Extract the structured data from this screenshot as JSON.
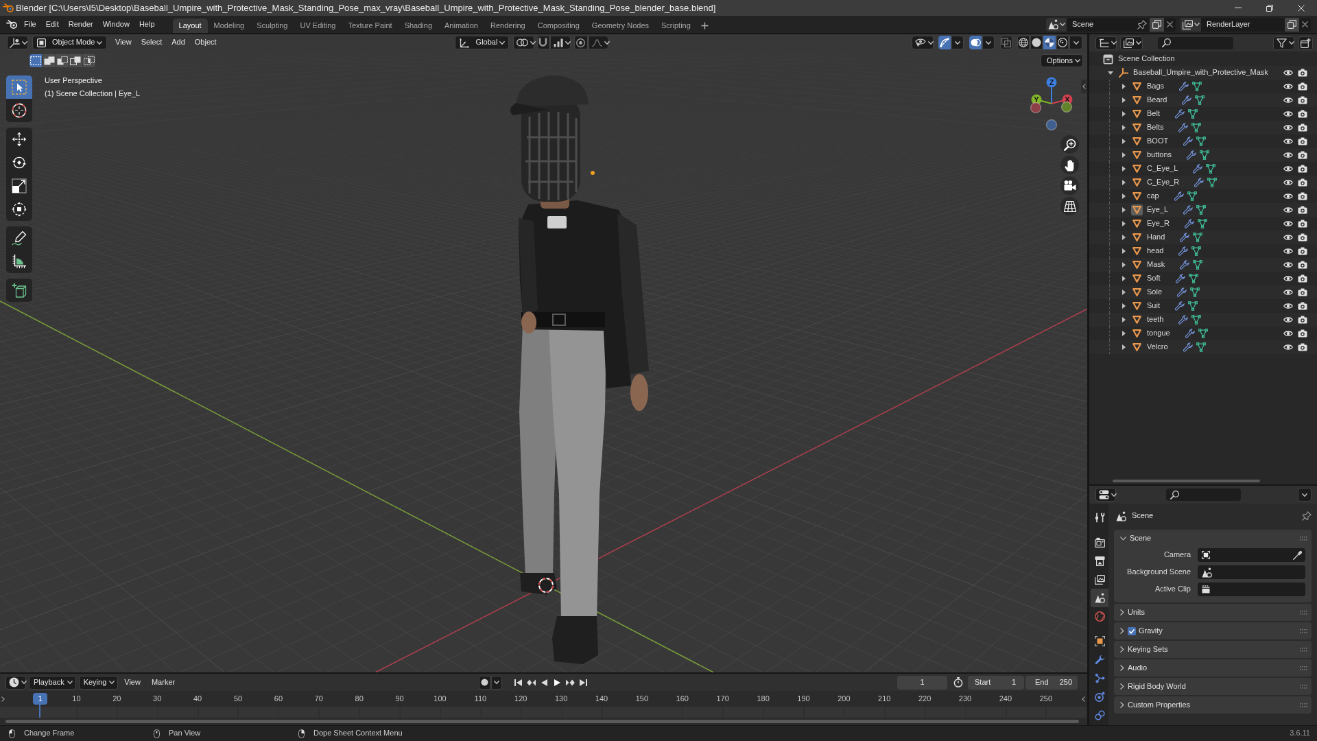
{
  "window": {
    "title": "Blender [C:\\Users\\I5\\Desktop\\Baseball_Umpire_with_Protective_Mask_Standing_Pose_max_vray\\Baseball_Umpire_with_Protective_Mask_Standing_Pose_blender_base.blend]"
  },
  "menu": [
    "File",
    "Edit",
    "Render",
    "Window",
    "Help"
  ],
  "workspaces": [
    {
      "label": "Layout",
      "selected": true
    },
    {
      "label": "Modeling",
      "selected": false
    },
    {
      "label": "Sculpting",
      "selected": false
    },
    {
      "label": "UV Editing",
      "selected": false
    },
    {
      "label": "Texture Paint",
      "selected": false
    },
    {
      "label": "Shading",
      "selected": false
    },
    {
      "label": "Animation",
      "selected": false
    },
    {
      "label": "Rendering",
      "selected": false
    },
    {
      "label": "Compositing",
      "selected": false
    },
    {
      "label": "Geometry Nodes",
      "selected": false
    },
    {
      "label": "Scripting",
      "selected": false
    }
  ],
  "scene": {
    "name": "Scene"
  },
  "view_layer": {
    "name": "RenderLayer"
  },
  "viewport": {
    "mode": "Object Mode",
    "menus": [
      "View",
      "Select",
      "Add",
      "Object"
    ],
    "orientation": "Global",
    "snap": false,
    "proportional_editing": false,
    "gizmos": true,
    "overlays": true,
    "xray": false,
    "shading": [
      {
        "kind": "wireframe",
        "selected": false
      },
      {
        "kind": "solid",
        "selected": false
      },
      {
        "kind": "material",
        "selected": true
      },
      {
        "kind": "rendered",
        "selected": false
      }
    ],
    "options": "Options",
    "select_modes": [
      {
        "kind": "set",
        "selected": true
      },
      {
        "kind": "extend",
        "selected": false
      },
      {
        "kind": "subtract",
        "selected": false
      },
      {
        "kind": "invert",
        "selected": false
      },
      {
        "kind": "intersect",
        "selected": false
      }
    ],
    "toolbar": [
      {
        "tools": [
          {
            "kind": "select_box",
            "selected": true
          },
          {
            "kind": "cursor",
            "selected": false
          }
        ]
      },
      {
        "tools": [
          {
            "kind": "move",
            "selected": false
          },
          {
            "kind": "rotate",
            "selected": false
          },
          {
            "kind": "scale",
            "selected": false
          },
          {
            "kind": "transform",
            "selected": false
          }
        ]
      },
      {
        "tools": [
          {
            "kind": "annotate",
            "selected": false
          },
          {
            "kind": "measure",
            "selected": false
          }
        ]
      },
      {
        "tools": [
          {
            "kind": "add_cube",
            "selected": false
          }
        ]
      }
    ],
    "info": [
      "User Perspective",
      "(1) Scene Collection | Eye_L"
    ],
    "axes": [
      {
        "kind": "positive",
        "label": "Z",
        "color": "#3d7fe0"
      },
      {
        "kind": "positive",
        "label": "Y",
        "color": "#82b428"
      },
      {
        "kind": "positive",
        "label": "X",
        "color": "#d0404f"
      },
      {
        "kind": "negative",
        "color": "#3e5f8f"
      },
      {
        "kind": "negative",
        "color": "#62822c"
      },
      {
        "kind": "negative",
        "color": "#8e4049"
      }
    ]
  },
  "outliner": {
    "root": "Scene Collection",
    "tree": [
      {
        "name": "Baseball_Umpire_with_Protective_Mask",
        "kind": "empty",
        "expanded": true,
        "selected": false,
        "visible": true,
        "renderable": true,
        "children": [
          {
            "name": "Bags",
            "kind": "mesh",
            "expanded": false,
            "selected": false,
            "modifiers": true,
            "visible": true,
            "renderable": true
          },
          {
            "name": "Beard",
            "kind": "mesh",
            "expanded": false,
            "selected": false,
            "modifiers": true,
            "visible": true,
            "renderable": true
          },
          {
            "name": "Belt",
            "kind": "mesh",
            "expanded": false,
            "selected": false,
            "modifiers": true,
            "visible": true,
            "renderable": true
          },
          {
            "name": "Belts",
            "kind": "mesh",
            "expanded": false,
            "selected": false,
            "modifiers": true,
            "visible": true,
            "renderable": true
          },
          {
            "name": "BOOT",
            "kind": "mesh",
            "expanded": false,
            "selected": false,
            "modifiers": true,
            "visible": true,
            "renderable": true
          },
          {
            "name": "buttons",
            "kind": "mesh",
            "expanded": false,
            "selected": false,
            "modifiers": true,
            "visible": true,
            "renderable": true
          },
          {
            "name": "C_Eye_L",
            "kind": "mesh",
            "expanded": false,
            "selected": false,
            "modifiers": true,
            "visible": true,
            "renderable": true
          },
          {
            "name": "C_Eye_R",
            "kind": "mesh",
            "expanded": false,
            "selected": false,
            "modifiers": true,
            "visible": true,
            "renderable": true
          },
          {
            "name": "cap",
            "kind": "mesh",
            "expanded": false,
            "selected": false,
            "modifiers": true,
            "visible": true,
            "renderable": true
          },
          {
            "name": "Eye_L",
            "kind": "mesh",
            "expanded": false,
            "selected": true,
            "modifiers": true,
            "visible": true,
            "renderable": true
          },
          {
            "name": "Eye_R",
            "kind": "mesh",
            "expanded": false,
            "selected": false,
            "modifiers": true,
            "visible": true,
            "renderable": true
          },
          {
            "name": "Hand",
            "kind": "mesh",
            "expanded": false,
            "selected": false,
            "modifiers": true,
            "visible": true,
            "renderable": true
          },
          {
            "name": "head",
            "kind": "mesh",
            "expanded": false,
            "selected": false,
            "modifiers": true,
            "visible": true,
            "renderable": true
          },
          {
            "name": "Mask",
            "kind": "mesh",
            "expanded": false,
            "selected": false,
            "modifiers": true,
            "visible": true,
            "renderable": true
          },
          {
            "name": "Soft",
            "kind": "mesh",
            "expanded": false,
            "selected": false,
            "modifiers": true,
            "visible": true,
            "renderable": true
          },
          {
            "name": "Sole",
            "kind": "mesh",
            "expanded": false,
            "selected": false,
            "modifiers": true,
            "visible": true,
            "renderable": true
          },
          {
            "name": "Suit",
            "kind": "mesh",
            "expanded": false,
            "selected": false,
            "modifiers": true,
            "visible": true,
            "renderable": true
          },
          {
            "name": "teeth",
            "kind": "mesh",
            "expanded": false,
            "selected": false,
            "modifiers": true,
            "visible": true,
            "renderable": true
          },
          {
            "name": "tongue",
            "kind": "mesh",
            "expanded": false,
            "selected": false,
            "modifiers": true,
            "visible": true,
            "renderable": true
          },
          {
            "name": "Velcro",
            "kind": "mesh",
            "expanded": false,
            "selected": false,
            "modifiers": true,
            "visible": true,
            "renderable": true
          }
        ]
      }
    ]
  },
  "properties": {
    "tab_groups": [
      {
        "tabs": [
          {
            "kind": "tool",
            "selected": false
          }
        ]
      },
      {
        "tabs": [
          {
            "kind": "render",
            "selected": false
          },
          {
            "kind": "output",
            "selected": false
          },
          {
            "kind": "view_layer",
            "selected": false
          },
          {
            "kind": "scene",
            "selected": true
          },
          {
            "kind": "world",
            "selected": false
          }
        ]
      },
      {
        "tabs": [
          {
            "kind": "object",
            "selected": false
          },
          {
            "kind": "modifiers",
            "selected": false
          },
          {
            "kind": "particles",
            "selected": false
          },
          {
            "kind": "physics",
            "selected": false
          },
          {
            "kind": "constraints",
            "selected": false
          }
        ]
      }
    ],
    "context": "Scene",
    "panels": [
      {
        "title": "Scene",
        "kind": "plain",
        "expanded": true,
        "fields": [
          {
            "label": "Camera",
            "kind": "object"
          },
          {
            "label": "Background Scene",
            "kind": "scene"
          },
          {
            "label": "Active Clip",
            "kind": "clip"
          }
        ]
      },
      {
        "title": "Units",
        "kind": "plain",
        "expanded": false
      },
      {
        "title": "Gravity",
        "kind": "checkbox",
        "checked": true,
        "expanded": false
      },
      {
        "title": "Keying Sets",
        "kind": "plain",
        "expanded": false
      },
      {
        "title": "Audio",
        "kind": "plain",
        "expanded": false
      },
      {
        "title": "Rigid Body World",
        "kind": "plain",
        "expanded": false
      },
      {
        "title": "Custom Properties",
        "kind": "plain",
        "expanded": false
      }
    ]
  },
  "timeline": {
    "menus": [
      {
        "label": "Playback",
        "kind": "dropdown"
      },
      {
        "label": "Keying",
        "kind": "dropdown"
      },
      {
        "label": "View",
        "kind": "menu"
      },
      {
        "label": "Marker",
        "kind": "menu"
      }
    ],
    "auto_keying": false,
    "current_frame": "1",
    "start_label": "Start",
    "start": "1",
    "end_label": "End",
    "end": "250",
    "playhead": "1",
    "ruler": [
      "10",
      "20",
      "30",
      "40",
      "50",
      "60",
      "70",
      "80",
      "90",
      "100",
      "110",
      "120",
      "130",
      "140",
      "150",
      "160",
      "170",
      "180",
      "190",
      "200",
      "210",
      "220",
      "230",
      "240",
      "250"
    ]
  },
  "status_bar": {
    "hints": [
      {
        "kind": "left_click",
        "text": "Change Frame"
      },
      {
        "kind": "middle_click",
        "text": "Pan View"
      },
      {
        "kind": "right_click",
        "text": "Dope Sheet Context Menu"
      }
    ],
    "version": "3.6.11"
  }
}
